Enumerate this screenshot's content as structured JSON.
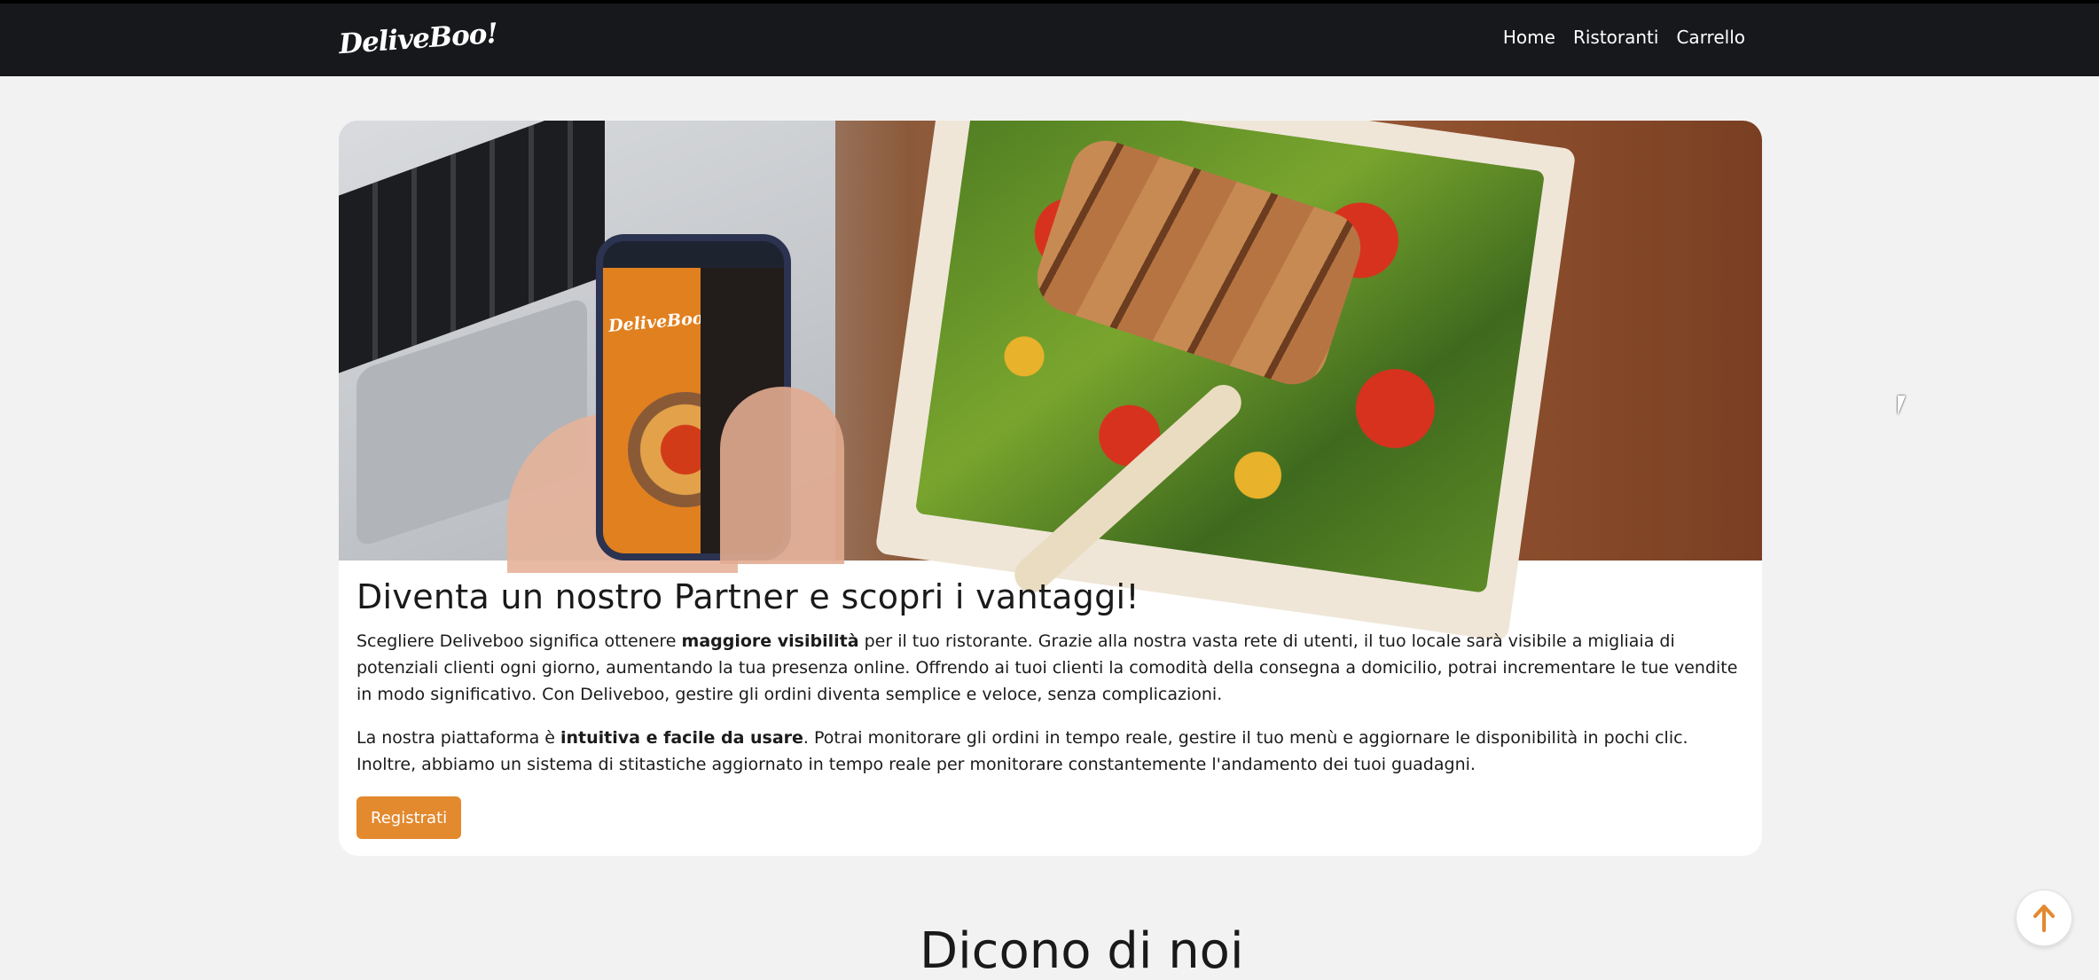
{
  "header": {
    "logo_text": "DeliveBoo!",
    "nav": [
      "Home",
      "Ristoranti",
      "Carrello"
    ]
  },
  "partner": {
    "title": "Diventa un nostro Partner e scopri i vantaggi!",
    "p1_a": "Scegliere Deliveboo significa ottenere ",
    "p1_bold": "maggiore visibilità",
    "p1_b": " per il tuo ristorante. Grazie alla nostra vasta rete di utenti, il tuo locale sarà visibile a migliaia di potenziali clienti ogni giorno, aumentando la tua presenza online. Offrendo ai tuoi clienti la comodità della consegna a domicilio, potrai incrementare le tue vendite in modo significativo. Con Deliveboo, gestire gli ordini diventa semplice e veloce, senza complicazioni.",
    "p2_a": "La nostra piattaforma è ",
    "p2_bold": "intuitiva e facile da usare",
    "p2_b": ". Potrai monitorare gli ordini in tempo reale, gestire il tuo menù e aggiornare le disponibilità in pochi clic. Inoltre, abbiamo un sistema di stitastiche aggiornato in tempo reale per monitorare constantemente l'andamento dei tuoi guadagni.",
    "button": "Registrati"
  },
  "next_section": {
    "title": "Dicono di noi"
  },
  "phone_logo": "DeliveBoo!",
  "colors": {
    "accent": "#e3892e",
    "topbar": "#16181b",
    "background": "#f3f2f2"
  },
  "icons": {
    "scroll_top": "arrow-up-icon"
  }
}
